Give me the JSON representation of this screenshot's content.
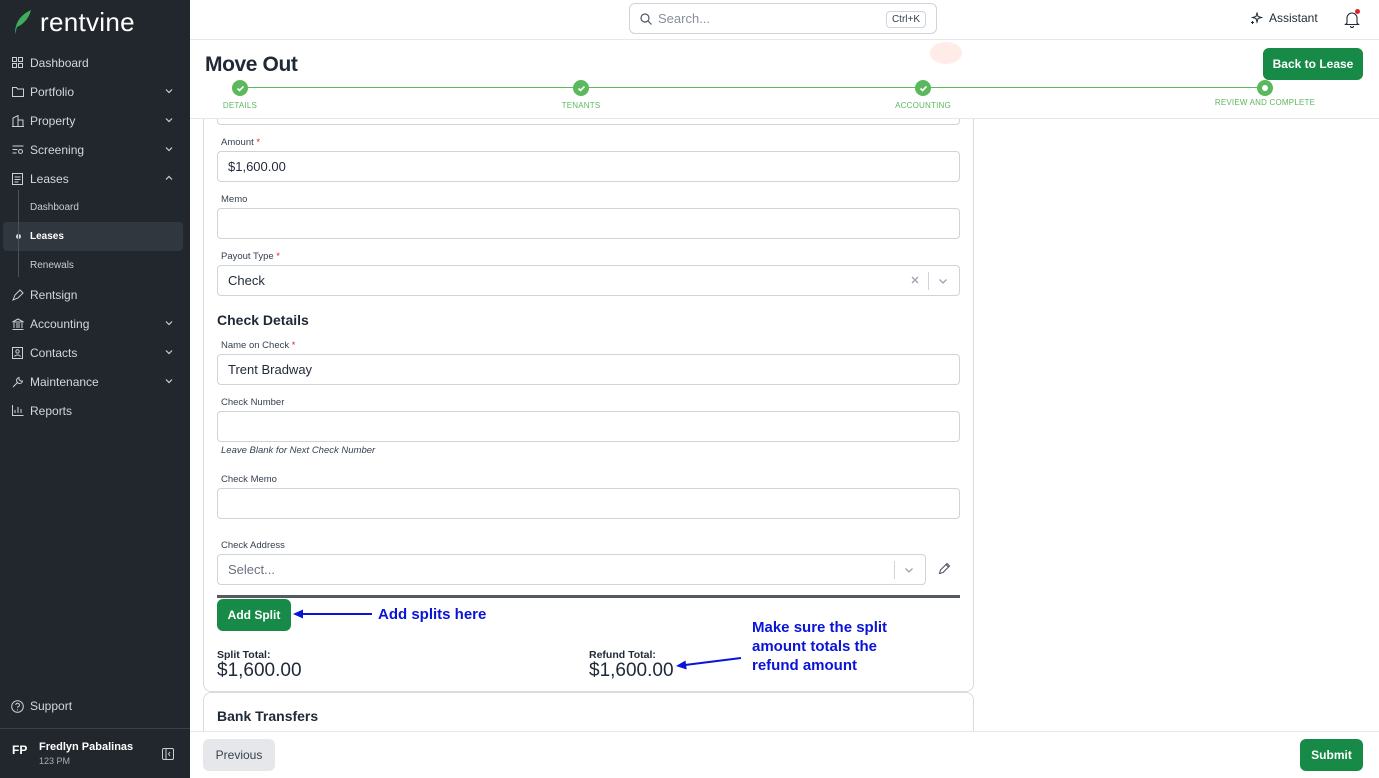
{
  "app": {
    "brand": "rentvine"
  },
  "sidebar": {
    "items": [
      {
        "label": "Dashboard",
        "icon": "grid-icon",
        "chevron": false
      },
      {
        "label": "Portfolio",
        "icon": "folder-icon",
        "chevron": true
      },
      {
        "label": "Property",
        "icon": "building-icon",
        "chevron": true
      },
      {
        "label": "Screening",
        "icon": "screening-icon",
        "chevron": true
      },
      {
        "label": "Leases",
        "icon": "document-icon",
        "chevron": "up"
      }
    ],
    "lease_sub": [
      {
        "label": "Dashboard"
      },
      {
        "label": "Leases",
        "active": true
      },
      {
        "label": "Renewals"
      }
    ],
    "items_after": [
      {
        "label": "Rentsign",
        "icon": "pen-icon",
        "chevron": false
      },
      {
        "label": "Accounting",
        "icon": "bank-icon",
        "chevron": true
      },
      {
        "label": "Contacts",
        "icon": "contact-icon",
        "chevron": true
      },
      {
        "label": "Maintenance",
        "icon": "wrench-icon",
        "chevron": true
      },
      {
        "label": "Reports",
        "icon": "chart-icon",
        "chevron": false
      }
    ],
    "support": "Support",
    "user": {
      "initials": "FP",
      "name": "Fredlyn Pabalinas",
      "sub": "123 PM"
    }
  },
  "topbar": {
    "search_placeholder": "Search...",
    "shortcut": "Ctrl+K",
    "assistant": "Assistant"
  },
  "header": {
    "title": "Move Out",
    "back_button": "Back to Lease",
    "steps": [
      {
        "label": "DETAILS",
        "state": "done"
      },
      {
        "label": "TENANTS",
        "state": "done"
      },
      {
        "label": "ACCOUNTING",
        "state": "done"
      },
      {
        "label": "REVIEW AND COMPLETE",
        "state": "current"
      }
    ]
  },
  "form": {
    "amount_label": "Amount",
    "amount_value": "$1,600.00",
    "memo_label": "Memo",
    "memo_value": "",
    "payout_type_label": "Payout Type",
    "payout_type_value": "Check",
    "check_details_heading": "Check Details",
    "name_on_check_label": "Name on Check",
    "name_on_check_value": "Trent Bradway",
    "check_number_label": "Check Number",
    "check_number_hint": "Leave Blank for Next Check Number",
    "check_memo_label": "Check Memo",
    "check_address_label": "Check Address",
    "check_address_placeholder": "Select...",
    "add_split_button": "Add Split",
    "split_total_label": "Split Total:",
    "split_total_value": "$1,600.00",
    "refund_total_label": "Refund Total:",
    "refund_total_value": "$1,600.00",
    "required_mark": "*"
  },
  "annotations": {
    "add_splits": "Add splits here",
    "split_note_1": "Make sure the split",
    "split_note_2": "amount totals the",
    "split_note_3": "refund amount",
    "color": "#0a14d6"
  },
  "bank_transfers": {
    "title": "Bank Transfers"
  },
  "footer": {
    "previous": "Previous",
    "submit": "Submit"
  },
  "colors": {
    "brand_green": "#168a46",
    "step_green": "#5cb85c",
    "sidebar_bg": "#22272e"
  }
}
